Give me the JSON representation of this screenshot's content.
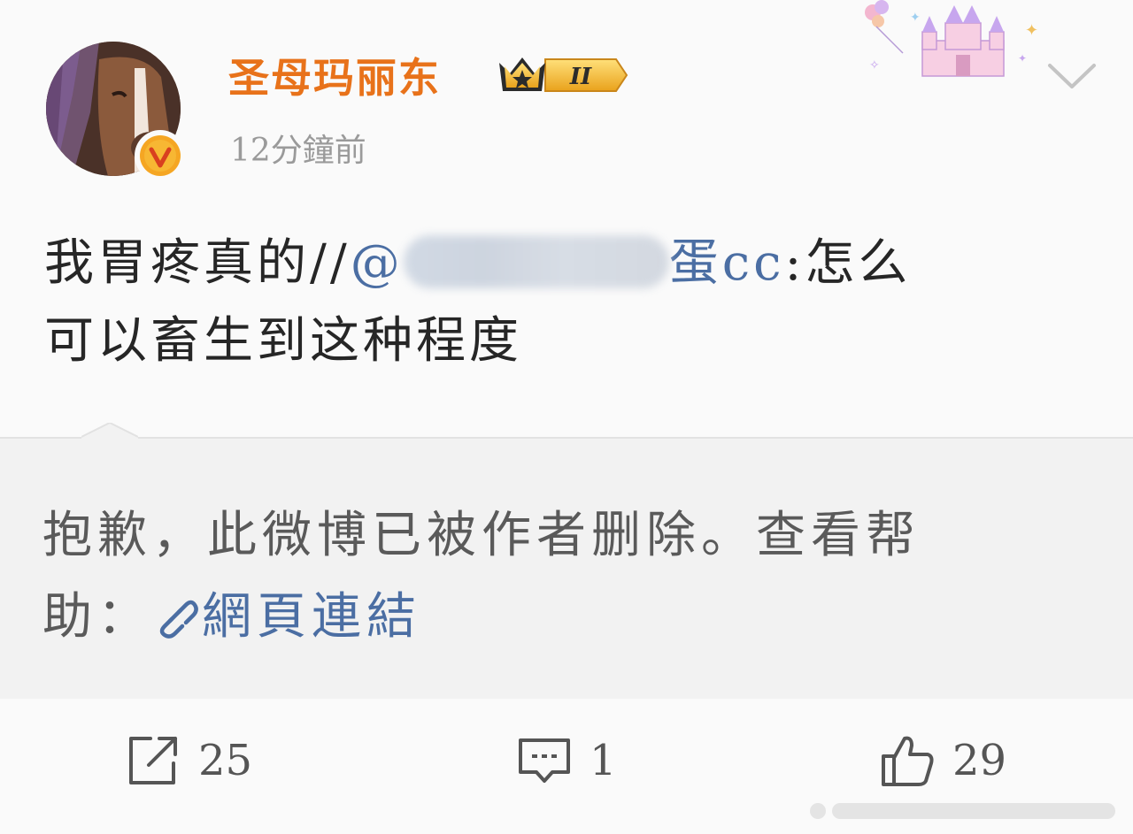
{
  "post": {
    "username": "圣母玛丽东",
    "badge_level": "II",
    "timestamp": "12分鐘前",
    "text_prefix": "我胃疼真的//",
    "mention_at": "@",
    "mention_partial_start": "",
    "mention_partial_end": "蛋cc",
    "text_after_mention_line1": ":怎么",
    "text_line2": "可以畜生到这种程度"
  },
  "quoted": {
    "deleted_notice_line1": "抱歉，此微博已被作者删除。查看帮",
    "deleted_notice_line2_prefix": "助：",
    "help_link_label": "網頁連結"
  },
  "actions": {
    "repost_count": "25",
    "comment_count": "1",
    "like_count": "29"
  },
  "colors": {
    "username": "#e8721a",
    "link": "#4b6ea3",
    "verified": "#f5a623",
    "badge_gold": "#f4b82a"
  },
  "icons": {
    "avatar": "horse-avatar",
    "verified": "verified-v-icon",
    "badge": "vip-crown-badge-icon",
    "decoration": "castle-balloons-decoration",
    "menu": "chevron-down-icon",
    "link": "link-icon",
    "repost": "repost-icon",
    "comment": "comment-icon",
    "like": "thumbs-up-icon"
  }
}
